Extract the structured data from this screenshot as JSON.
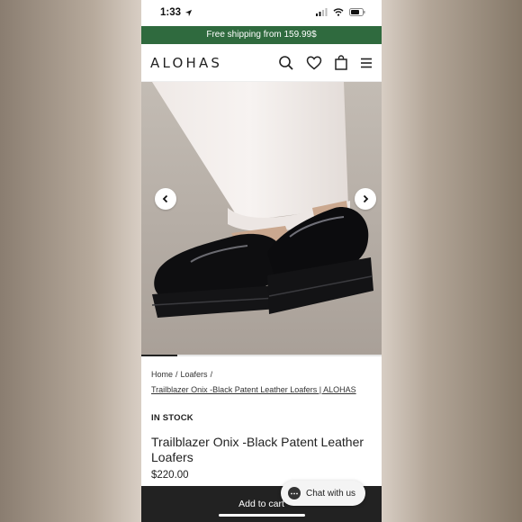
{
  "status": {
    "time": "1:33"
  },
  "promo": {
    "text": "Free shipping from 159.99$"
  },
  "header": {
    "logo": "ALOHAS",
    "icons": [
      "search-icon",
      "heart-icon",
      "bag-icon",
      "menu-icon"
    ]
  },
  "gallery": {
    "progress_fraction": 0.15
  },
  "breadcrumb": {
    "items": [
      "Home",
      "Loafers"
    ],
    "current": "Trailblazer Onix -Black Patent Leather Loafers | ALOHAS"
  },
  "product": {
    "stock": "IN STOCK",
    "title": "Trailblazer Onix -Black Patent Leather Loafers",
    "price": "$220.00"
  },
  "cart": {
    "label": "Add to cart"
  },
  "chat": {
    "label": "Chat with us"
  },
  "colors": {
    "promo_bg": "#2f6a3e",
    "cart_bg": "#222222"
  }
}
